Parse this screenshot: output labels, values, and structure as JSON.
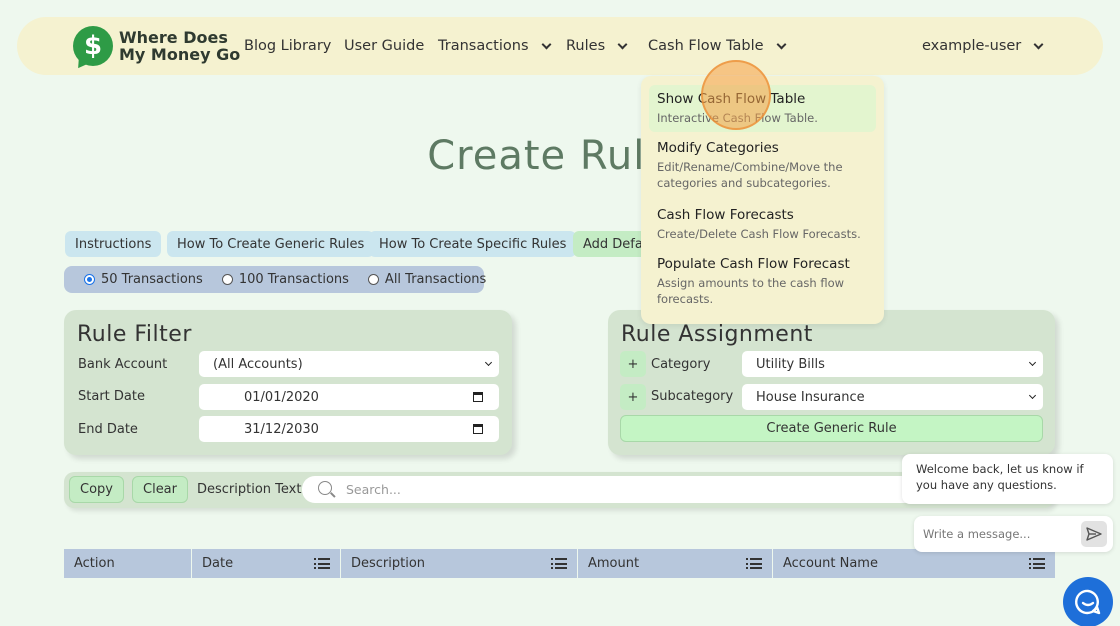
{
  "brand": {
    "name_line1": "Where Does",
    "name_line2": "My Money Go",
    "logo_symbol": "$"
  },
  "nav": {
    "blog": "Blog Library",
    "guide": "User Guide",
    "transactions": "Transactions",
    "rules": "Rules",
    "cashflow": "Cash Flow Table",
    "user": "example-user"
  },
  "dropdown": {
    "items": [
      {
        "title": "Show Cash Flow Table",
        "desc": "Interactive Cash Flow Table."
      },
      {
        "title": "Modify Categories",
        "desc": "Edit/Rename/Combine/Move the categories and subcategories."
      },
      {
        "title": "Cash Flow Forecasts",
        "desc": "Create/Delete Cash Flow Forecasts."
      },
      {
        "title": "Populate Cash Flow Forecast",
        "desc": "Assign amounts to the cash flow forecasts."
      }
    ]
  },
  "page_title": "Create Rules",
  "help_buttons": {
    "instructions": "Instructions",
    "generic": "How To Create Generic Rules",
    "specific": "How To Create Specific Rules",
    "defaults": "Add Default Rules"
  },
  "transaction_count": {
    "options": [
      "50 Transactions",
      "100 Transactions",
      "All Transactions"
    ],
    "selected": "50 Transactions"
  },
  "rule_filter": {
    "title": "Rule Filter",
    "bank_label": "Bank Account",
    "bank_value": "(All Accounts)",
    "start_label": "Start Date",
    "start_value": "01/01/2020",
    "end_label": "End Date",
    "end_value": "31/12/2030"
  },
  "rule_assignment": {
    "title": "Rule Assignment",
    "plus": "+",
    "category_label": "Category",
    "category_value": "Utility Bills",
    "subcategory_label": "Subcategory",
    "subcategory_value": "House Insurance",
    "create_button": "Create Generic Rule"
  },
  "search_bar": {
    "copy": "Copy",
    "clear": "Clear",
    "label": "Description Text",
    "placeholder": "Search..."
  },
  "table": {
    "columns": [
      "Action",
      "Date",
      "Description",
      "Amount",
      "Account Name"
    ]
  },
  "chat": {
    "greeting": "Welcome back, let us know if you have any questions.",
    "placeholder": "Write a message..."
  },
  "colors": {
    "accent_green": "#2e9b46",
    "chat_blue": "#1e6fd9",
    "nav_bg": "#f5f2d0"
  }
}
